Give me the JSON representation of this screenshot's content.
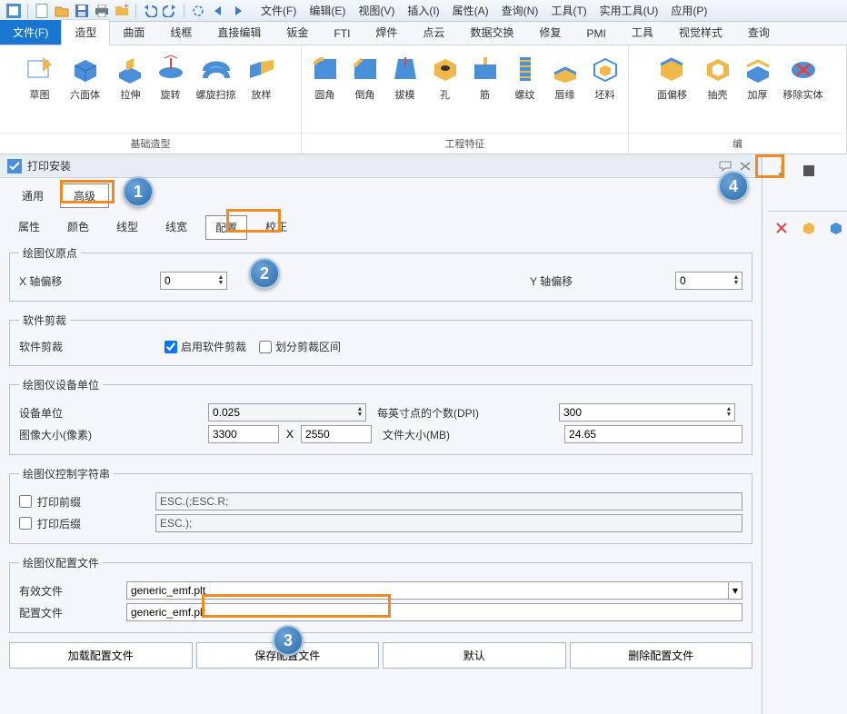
{
  "menubar": [
    "文件(F)",
    "编辑(E)",
    "视图(V)",
    "插入(I)",
    "属性(A)",
    "查询(N)",
    "工具(T)",
    "实用工具(U)",
    "应用(P)"
  ],
  "ribbon_tabs": [
    "文件(F)",
    "造型",
    "曲面",
    "线框",
    "直接编辑",
    "钣金",
    "FTI",
    "焊件",
    "点云",
    "数据交换",
    "修复",
    "PMI",
    "工具",
    "视觉样式",
    "查询"
  ],
  "ribbon": {
    "group1": {
      "label": "基础造型",
      "items": [
        "草图",
        "六面体",
        "拉伸",
        "旋转",
        "螺旋扫掠",
        "放样"
      ]
    },
    "group2": {
      "label": "工程特征",
      "items": [
        "圆角",
        "倒角",
        "拔模",
        "孔",
        "筋",
        "螺纹",
        "唇缘",
        "坯料"
      ]
    },
    "group3": {
      "label": "编",
      "items": [
        "面偏移",
        "抽壳",
        "加厚",
        "移除实体"
      ]
    }
  },
  "panel": {
    "title": "打印安装",
    "tabs_top": {
      "t1": "通用",
      "t2": "高级"
    },
    "tabs_sub": [
      "属性",
      "颜色",
      "线型",
      "线宽",
      "配置",
      "校正"
    ],
    "origin": {
      "legend": "绘图仪原点",
      "x_label": "X 轴偏移",
      "x_val": "0",
      "y_label": "Y 轴偏移",
      "y_val": "0"
    },
    "clip": {
      "legend": "软件剪裁",
      "label": "软件剪裁",
      "cb1": "启用软件剪裁",
      "cb2": "划分剪裁区间"
    },
    "units": {
      "legend": "绘图仪设备单位",
      "dev_label": "设备单位",
      "dev_val": "0.025",
      "dpi_label": "每英寸点的个数(DPI)",
      "dpi_val": "300",
      "img_label": "图像大小(像素)",
      "img_w": "3300",
      "img_x": "X",
      "img_h": "2550",
      "file_label": "文件大小(MB)",
      "file_val": "24.65"
    },
    "ctrl": {
      "legend": "绘图仪控制字符串",
      "pre_label": "打印前缀",
      "pre_val": "ESC.(;ESC.R;",
      "post_label": "打印后缀",
      "post_val": "ESC.);"
    },
    "cfg": {
      "legend": "绘图仪配置文件",
      "valid_label": "有效文件",
      "valid_val": "generic_emf.plt",
      "cfg_label": "配置文件",
      "cfg_val": "generic_emf.plt"
    },
    "buttons": [
      "加载配置文件",
      "保存配置文件",
      "默认",
      "删除配置文件"
    ]
  },
  "callouts": {
    "c1": "1",
    "c2": "2",
    "c3": "3",
    "c4": "4"
  }
}
